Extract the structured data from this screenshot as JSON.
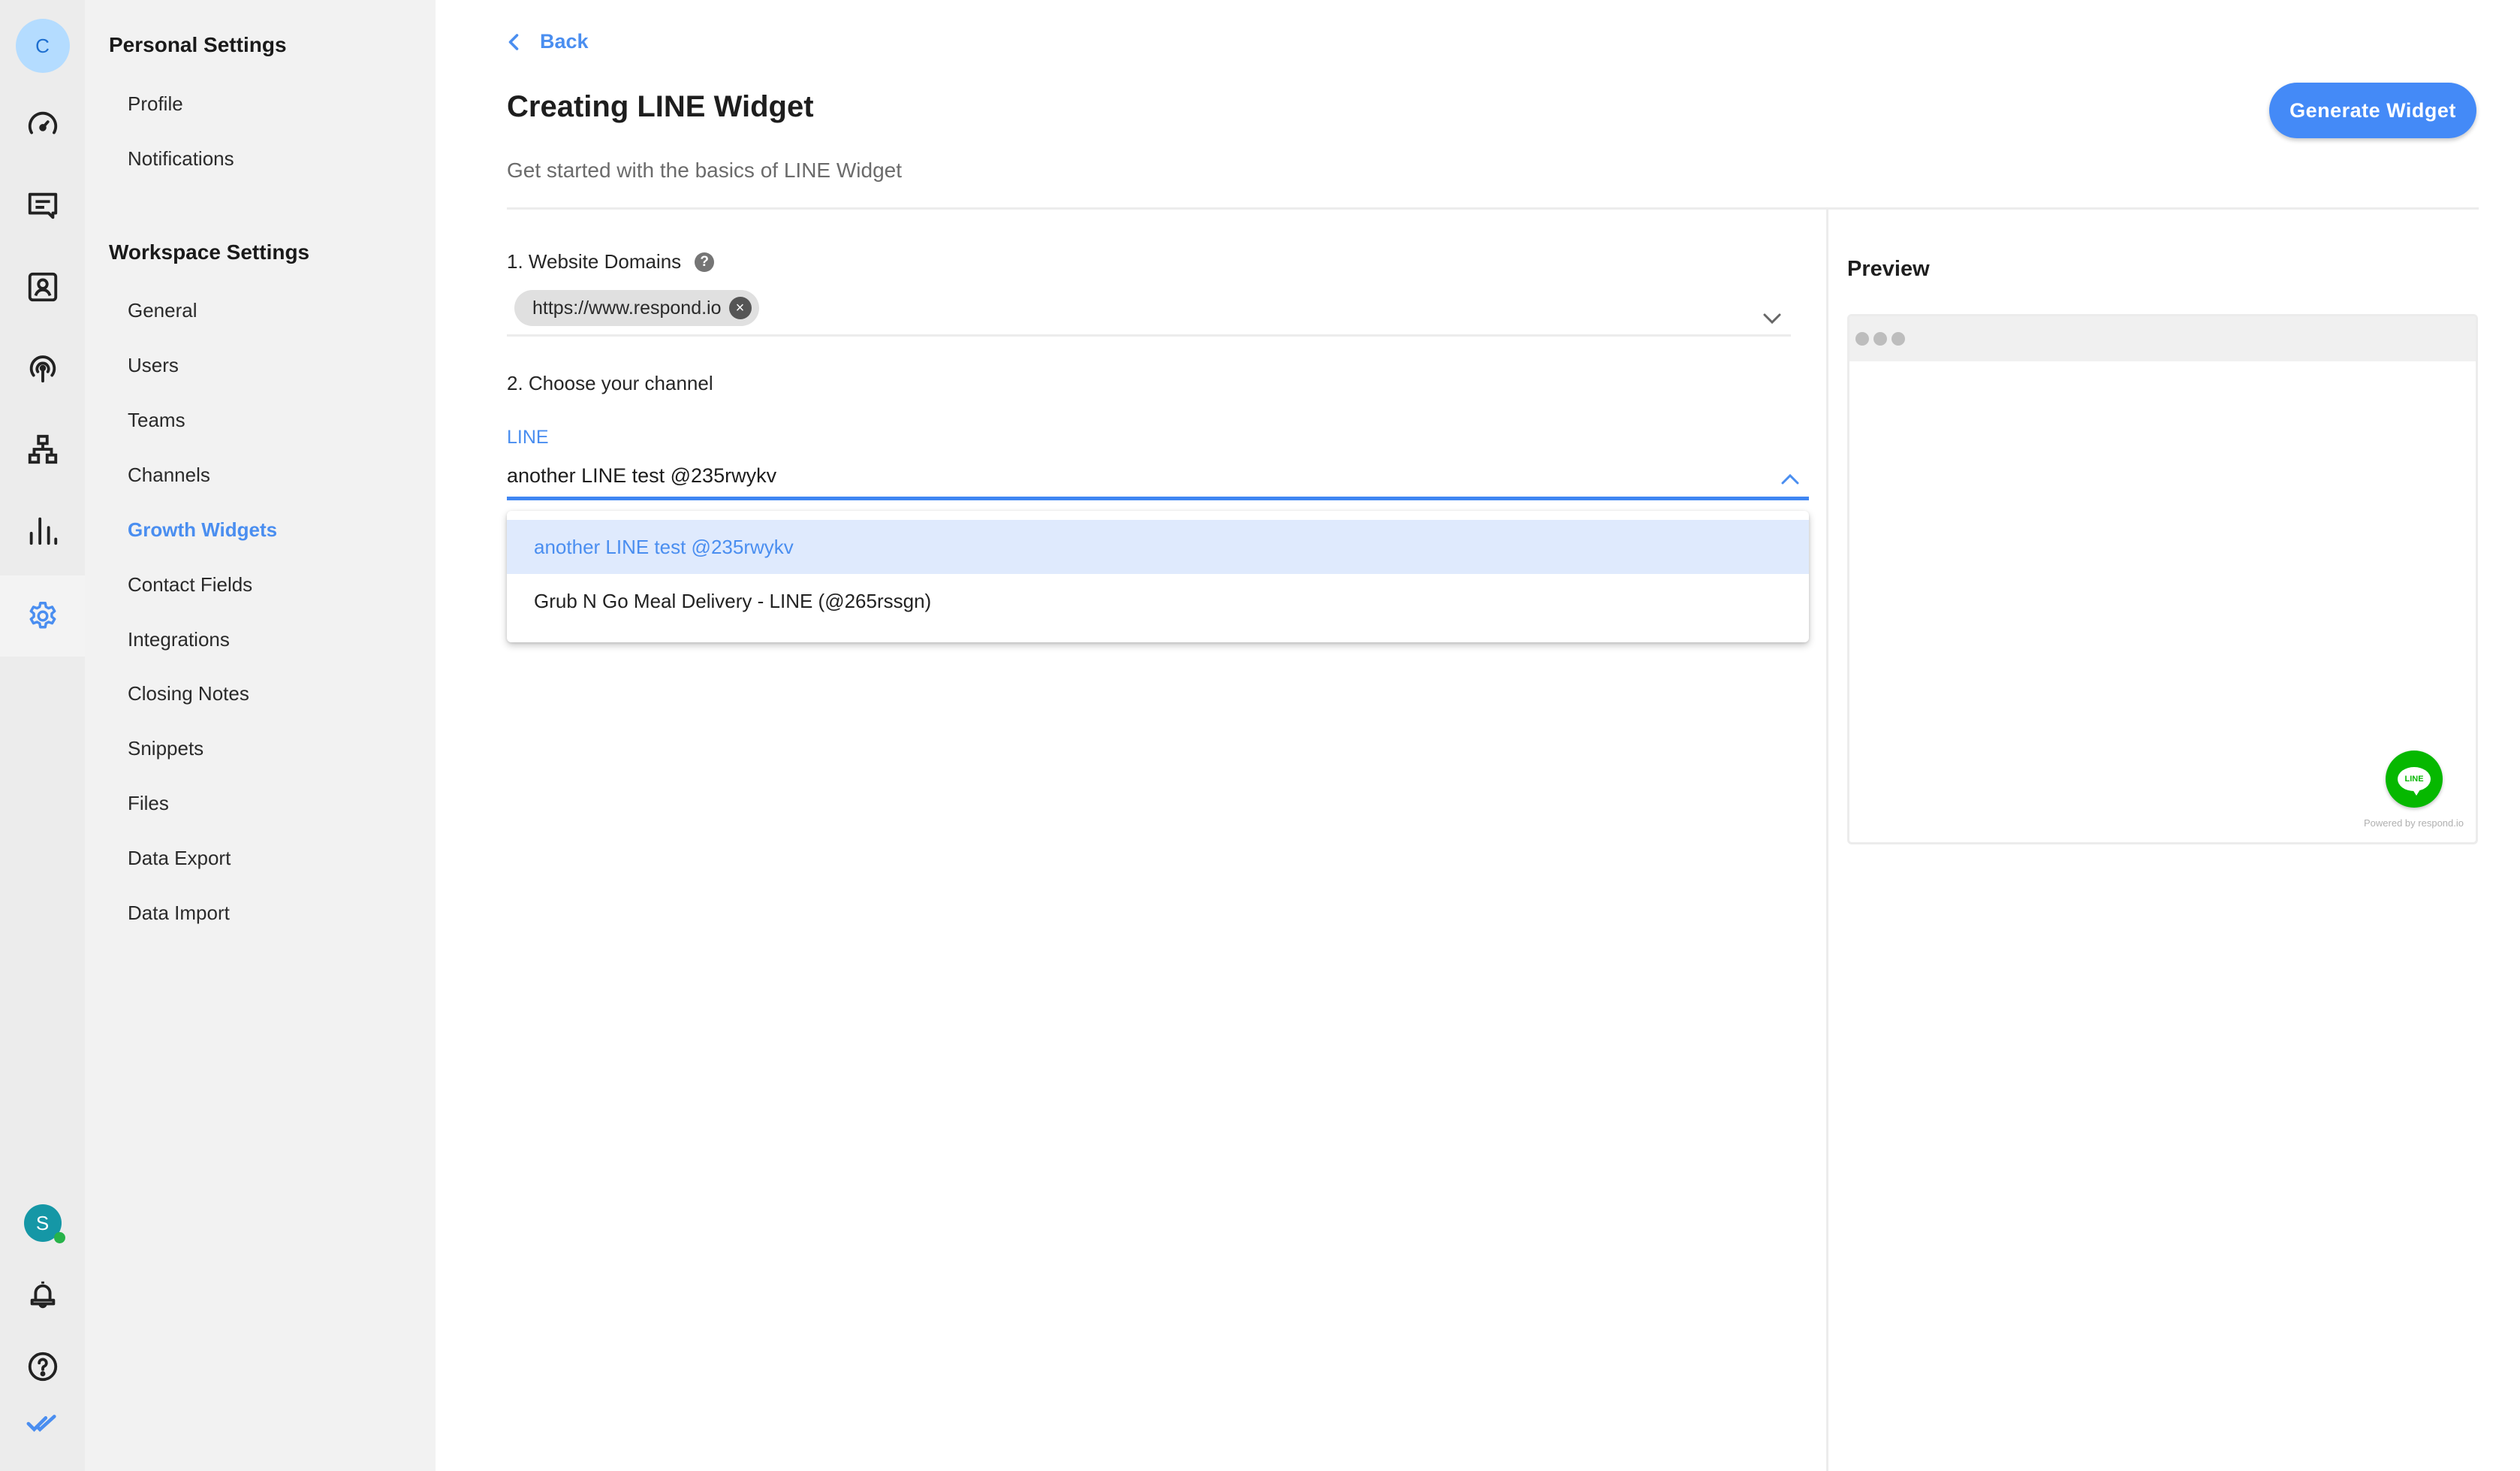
{
  "rail": {
    "avatar_initial": "C",
    "user_initial": "S",
    "icons": [
      {
        "name": "dashboard-icon"
      },
      {
        "name": "messages-icon"
      },
      {
        "name": "contacts-icon"
      },
      {
        "name": "broadcast-icon"
      },
      {
        "name": "workflows-icon"
      },
      {
        "name": "reports-icon"
      },
      {
        "name": "settings-icon",
        "active": true
      }
    ],
    "bottom_icons": [
      "notifications-icon",
      "help-icon",
      "logo-icon"
    ]
  },
  "settings": {
    "personal": {
      "title": "Personal Settings",
      "items": [
        "Profile",
        "Notifications"
      ]
    },
    "workspace": {
      "title": "Workspace Settings",
      "items": [
        "General",
        "Users",
        "Teams",
        "Channels",
        "Growth Widgets",
        "Contact Fields",
        "Integrations",
        "Closing Notes",
        "Snippets",
        "Files",
        "Data Export",
        "Data Import"
      ],
      "active": "Growth Widgets"
    }
  },
  "header": {
    "back_label": "Back",
    "title": "Creating LINE Widget",
    "subtitle": "Get started with the basics of LINE Widget",
    "generate_button": "Generate Widget"
  },
  "form": {
    "domains": {
      "label": "1. Website Domains",
      "help": "?",
      "chips": [
        "https://www.respond.io"
      ],
      "chip_remove": "×"
    },
    "channel": {
      "label": "2. Choose your channel",
      "field_label": "LINE",
      "value": "another LINE test @235rwykv",
      "options": [
        {
          "label": "another LINE test @235rwykv",
          "selected": true
        },
        {
          "label": "Grub N Go Meal Delivery - LINE (@265rssgn)",
          "selected": false
        }
      ]
    }
  },
  "preview": {
    "title": "Preview",
    "fab_label": "LINE",
    "powered_by": "Powered by respond.io"
  },
  "colors": {
    "accent": "#448af7",
    "line_green": "#06b800",
    "selected_option_bg": "#dfeafd"
  }
}
